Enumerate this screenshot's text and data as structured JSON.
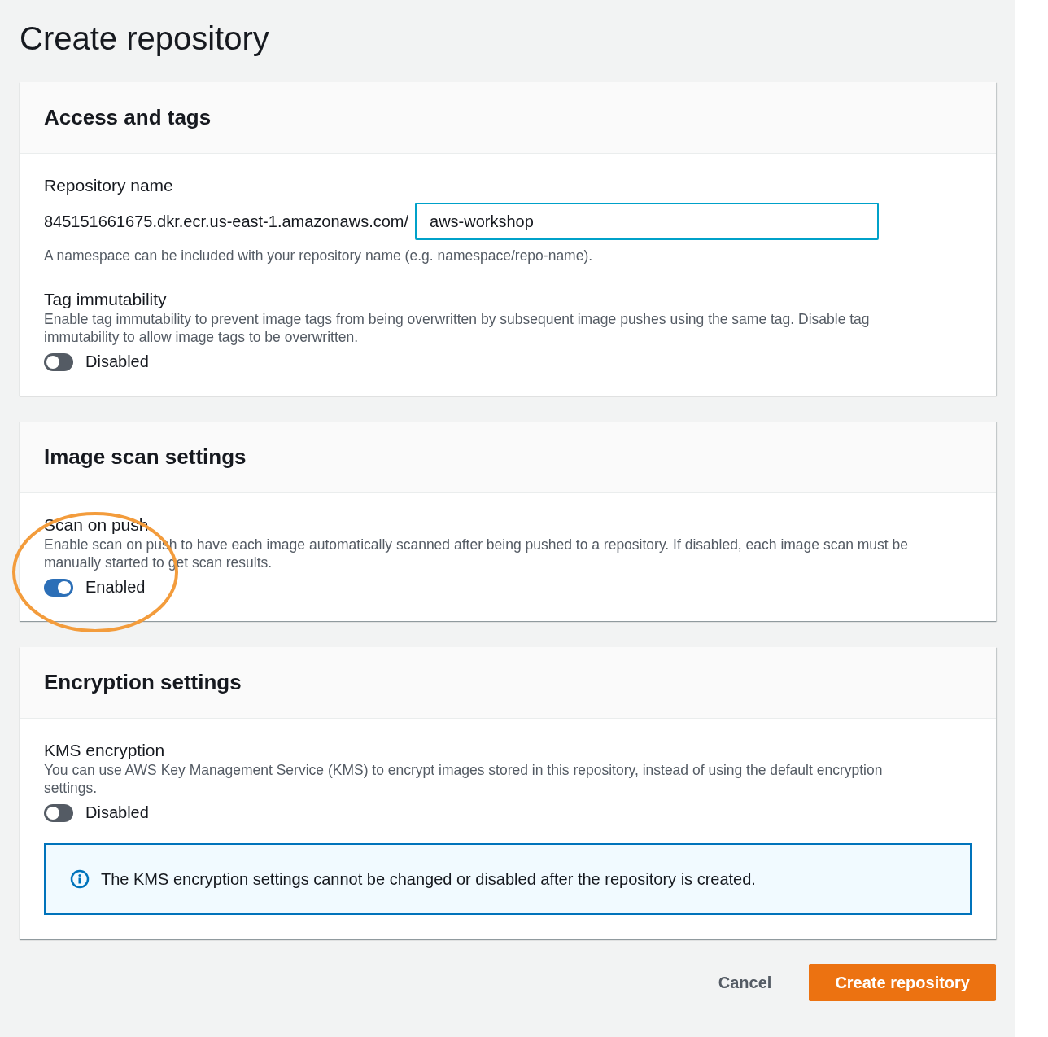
{
  "title": "Create repository",
  "panels": [
    {
      "title": "Access and tags",
      "fields": [
        {
          "kind": "repo-name",
          "label": "Repository name",
          "prefix": "845151661675.dkr.ecr.us-east-1.amazonaws.com/",
          "value": "aws-workshop",
          "hint": "A namespace can be included with your repository name (e.g. namespace/repo-name)."
        },
        {
          "kind": "toggle",
          "label": "Tag immutability",
          "description": "Enable tag immutability to prevent image tags from being overwritten by subsequent image pushes using the same tag. Disable tag immutability to allow image tags to be overwritten.",
          "on": false,
          "state_label": "Disabled",
          "highlighted": false
        }
      ]
    },
    {
      "title": "Image scan settings",
      "fields": [
        {
          "kind": "toggle",
          "label": "Scan on push",
          "description": "Enable scan on push to have each image automatically scanned after being pushed to a repository. If disabled, each image scan must be manually started to get scan results.",
          "on": true,
          "state_label": "Enabled",
          "highlighted": true
        }
      ]
    },
    {
      "title": "Encryption settings",
      "fields": [
        {
          "kind": "toggle",
          "label": "KMS encryption",
          "description": "You can use AWS Key Management Service (KMS) to encrypt images stored in this repository, instead of using the default encryption settings.",
          "on": false,
          "state_label": "Disabled",
          "highlighted": false
        },
        {
          "kind": "alert",
          "text": "The KMS encryption settings cannot be changed or disabled after the repository is created."
        }
      ]
    }
  ],
  "buttons": [
    {
      "label": "Cancel",
      "kind": "link"
    },
    {
      "label": "Create repository",
      "kind": "primary"
    }
  ]
}
